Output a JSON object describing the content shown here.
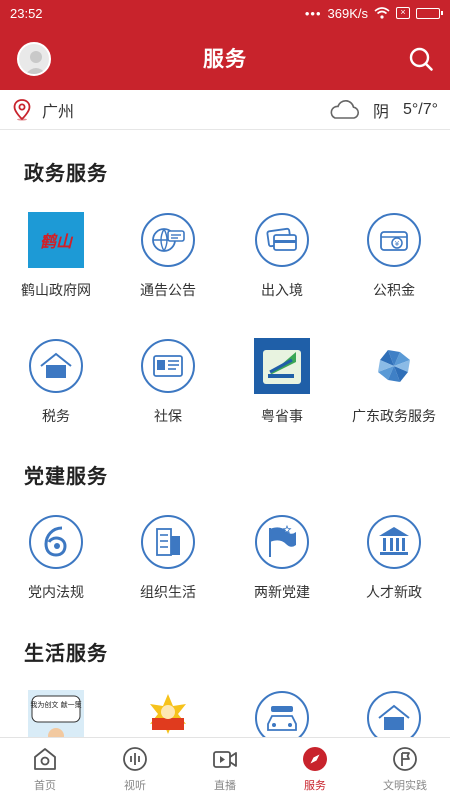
{
  "status_bar": {
    "time": "23:52",
    "network_speed": "369K/s",
    "dots": "•••"
  },
  "header": {
    "title": "服务"
  },
  "location": {
    "city": "广州",
    "weather": "阴",
    "temperature": "5°/7°"
  },
  "sections": [
    {
      "title": "政务服务",
      "rows": [
        [
          {
            "label": "鹤山政府网",
            "icon": "heshan-logo-icon"
          },
          {
            "label": "通告公告",
            "icon": "announcement-icon"
          },
          {
            "label": "出入境",
            "icon": "cards-icon"
          },
          {
            "label": "公积金",
            "icon": "housing-fund-icon"
          }
        ],
        [
          {
            "label": "税务",
            "icon": "house-icon"
          },
          {
            "label": "社保",
            "icon": "id-card-icon"
          },
          {
            "label": "粤省事",
            "icon": "yueshengshi-logo-icon"
          },
          {
            "label": "广东政务服务",
            "icon": "pinwheel-logo-icon"
          }
        ]
      ]
    },
    {
      "title": "党建服务",
      "rows": [
        [
          {
            "label": "党内法规",
            "icon": "law-icon"
          },
          {
            "label": "组织生活",
            "icon": "building-icon"
          },
          {
            "label": "两新党建",
            "icon": "flag-icon"
          },
          {
            "label": "人才新政",
            "icon": "institution-icon"
          }
        ]
      ]
    },
    {
      "title": "生活服务",
      "rows": [
        [
          {
            "label": "",
            "icon": "comic-icon",
            "text": "我为创文 献一策"
          },
          {
            "label": "",
            "icon": "mascot-icon"
          },
          {
            "label": "",
            "icon": "car-icon"
          },
          {
            "label": "",
            "icon": "house-icon"
          }
        ]
      ]
    }
  ],
  "tabs": [
    {
      "label": "首页",
      "icon": "home-icon",
      "active": false
    },
    {
      "label": "视听",
      "icon": "audio-icon",
      "active": false
    },
    {
      "label": "直播",
      "icon": "video-icon",
      "active": false
    },
    {
      "label": "服务",
      "icon": "compass-icon",
      "active": true
    },
    {
      "label": "文明实践",
      "icon": "civic-icon",
      "active": false
    }
  ],
  "colors": {
    "brand": "#c8232c",
    "icon_blue": "#4a7fc1",
    "icon_circle": "#3d78c2"
  }
}
